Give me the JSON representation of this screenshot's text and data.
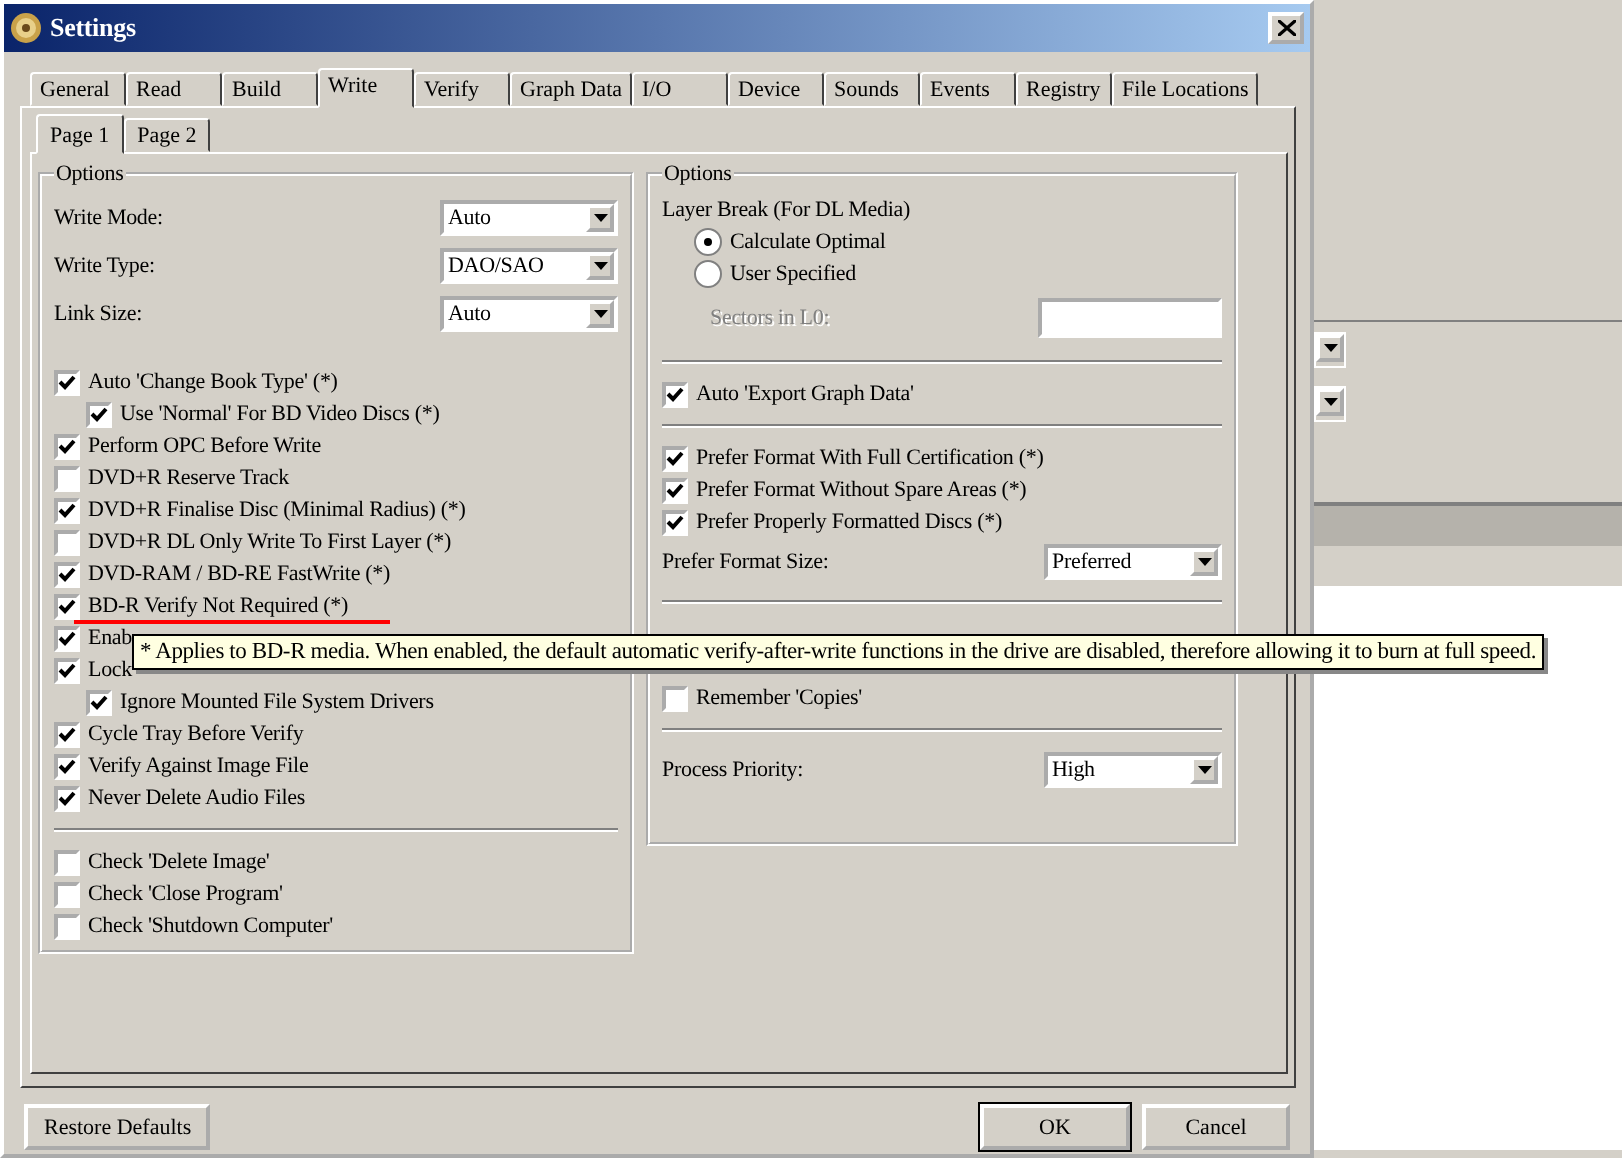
{
  "window": {
    "title": "Settings"
  },
  "tabs": [
    {
      "label": "General",
      "selected": false
    },
    {
      "label": "Read",
      "selected": false
    },
    {
      "label": "Build",
      "selected": false
    },
    {
      "label": "Write",
      "selected": true
    },
    {
      "label": "Verify",
      "selected": false
    },
    {
      "label": "Graph Data",
      "selected": false
    },
    {
      "label": "I/O",
      "selected": false
    },
    {
      "label": "Device",
      "selected": false
    },
    {
      "label": "Sounds",
      "selected": false
    },
    {
      "label": "Events",
      "selected": false
    },
    {
      "label": "Registry",
      "selected": false
    },
    {
      "label": "File Locations",
      "selected": false
    }
  ],
  "subtabs": [
    {
      "label": "Page 1",
      "selected": true
    },
    {
      "label": "Page 2",
      "selected": false
    }
  ],
  "left_group": {
    "title": "Options",
    "items": [
      {
        "kind": "dropdown",
        "label": "Write Mode:",
        "value": "Auto"
      },
      {
        "kind": "dropdown",
        "label": "Write Type:",
        "value": "DAO/SAO"
      },
      {
        "kind": "dropdown",
        "label": "Link Size:",
        "value": "Auto"
      },
      {
        "kind": "spacer"
      },
      {
        "kind": "checkbox",
        "label": "Auto 'Change Book Type' (*)",
        "checked": true,
        "children": [
          {
            "label": "Use 'Normal' For BD Video Discs (*)",
            "checked": true
          }
        ]
      },
      {
        "kind": "checkbox",
        "label": "Perform OPC Before Write",
        "checked": true
      },
      {
        "kind": "checkbox",
        "label": "DVD+R Reserve Track",
        "checked": false
      },
      {
        "kind": "checkbox",
        "label": "DVD+R Finalise Disc (Minimal Radius) (*)",
        "checked": true
      },
      {
        "kind": "checkbox",
        "label": "DVD+R DL Only Write To First Layer (*)",
        "checked": false
      },
      {
        "kind": "checkbox",
        "label": "DVD-RAM / BD-RE FastWrite (*)",
        "checked": true
      },
      {
        "kind": "checkbox",
        "label": "BD-R Verify Not Required (*)",
        "checked": true
      },
      {
        "kind": "checkbox",
        "label": "Enab",
        "checked": true
      },
      {
        "kind": "checkbox",
        "label": "Lock",
        "checked": true,
        "children": [
          {
            "label": "Ignore Mounted File System Drivers",
            "checked": true
          }
        ]
      },
      {
        "kind": "checkbox",
        "label": "Cycle Tray Before Verify",
        "checked": true
      },
      {
        "kind": "checkbox",
        "label": "Verify Against Image File",
        "checked": true
      },
      {
        "kind": "checkbox",
        "label": "Never Delete Audio Files",
        "checked": true
      },
      {
        "kind": "divider"
      },
      {
        "kind": "checkbox",
        "label": "Check 'Delete Image'",
        "checked": false
      },
      {
        "kind": "checkbox",
        "label": "Check 'Close Program'",
        "checked": false
      },
      {
        "kind": "checkbox",
        "label": "Check 'Shutdown Computer'",
        "checked": false
      }
    ]
  },
  "right_group": {
    "title": "Options",
    "items": [
      {
        "kind": "heading",
        "label": "Layer Break (For DL Media)"
      },
      {
        "kind": "radio",
        "label": "Calculate Optimal",
        "selected": true
      },
      {
        "kind": "radio",
        "label": "User Specified",
        "selected": false
      },
      {
        "kind": "field",
        "label": "Sectors in L0:",
        "disabled": true
      },
      {
        "kind": "divider"
      },
      {
        "kind": "checkbox",
        "label": "Auto 'Export Graph Data'",
        "checked": true
      },
      {
        "kind": "divider"
      },
      {
        "kind": "checkbox",
        "label": "Prefer Format With Full Certification (*)",
        "checked": true
      },
      {
        "kind": "checkbox",
        "label": "Prefer Format Without Spare Areas (*)",
        "checked": true
      },
      {
        "kind": "checkbox",
        "label": "Prefer Properly Formatted Discs (*)",
        "checked": true
      },
      {
        "kind": "dropdown",
        "label": "Prefer Format Size:",
        "value": "Preferred"
      },
      {
        "kind": "divider"
      },
      {
        "kind": "spacer"
      },
      {
        "kind": "divider"
      },
      {
        "kind": "checkbox",
        "label": "Remember 'Copies'",
        "checked": false
      },
      {
        "kind": "divider"
      },
      {
        "kind": "dropdown",
        "label": "Process Priority:",
        "value": "High"
      }
    ]
  },
  "buttons": [
    {
      "label": "Restore Defaults",
      "default": false
    },
    {
      "label": "OK",
      "default": true
    },
    {
      "label": "Cancel",
      "default": false
    }
  ],
  "tooltip": {
    "text": "* Applies to BD-R media. When enabled, the default automatic verify-after-write functions in the drive are disabled, therefore allowing it to burn at full speed."
  }
}
